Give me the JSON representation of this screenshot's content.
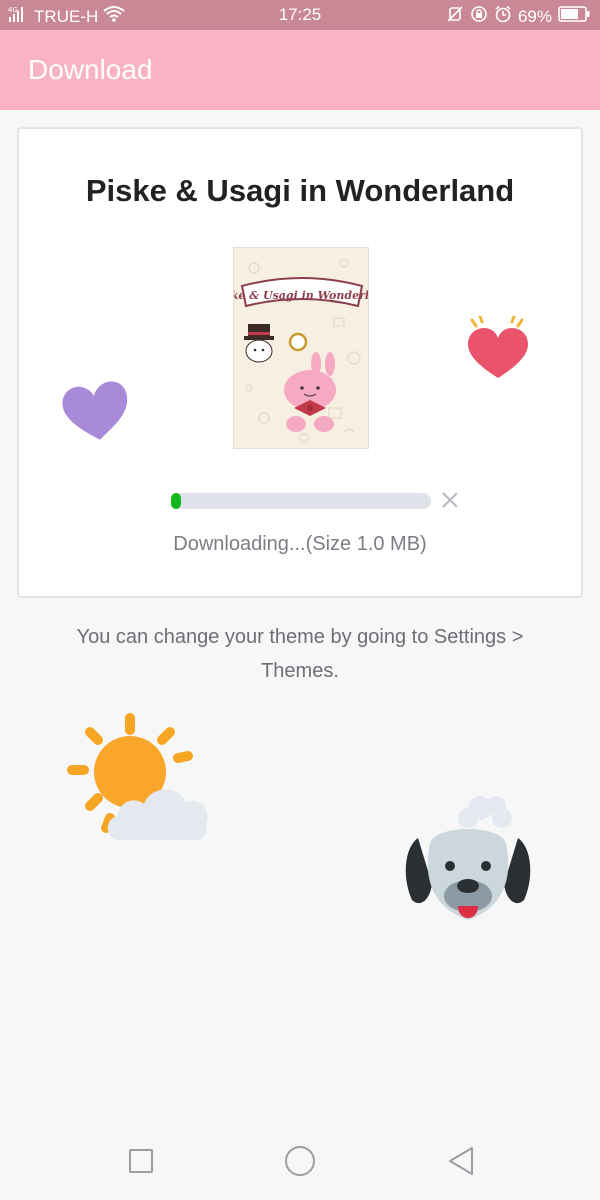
{
  "status_bar": {
    "network": "4G",
    "carrier": "TRUE-H",
    "time": "17:25",
    "battery": "69%",
    "icons": [
      "signal-icon",
      "wifi-icon",
      "mute-icon",
      "rotation-lock-icon",
      "alarm-icon",
      "battery-icon"
    ]
  },
  "app_bar": {
    "title": "Download",
    "color": "#f9b3c5"
  },
  "card": {
    "theme_name": "Piske & Usagi in Wonderland",
    "thumbnail_title": "Piske & Usagi in Wonderland",
    "progress": 0.03,
    "progress_color": "#15b81a",
    "status_text": "Downloading...(Size 1.0 MB)"
  },
  "hint_text": "You can change your theme by going to Settings > Themes.",
  "decorations": [
    "purple-heart-icon",
    "red-heart-icon",
    "sun-behind-cloud-icon",
    "dog-icon"
  ],
  "nav_bar": {
    "icons": [
      "recent-apps-icon",
      "home-icon",
      "back-icon"
    ]
  }
}
